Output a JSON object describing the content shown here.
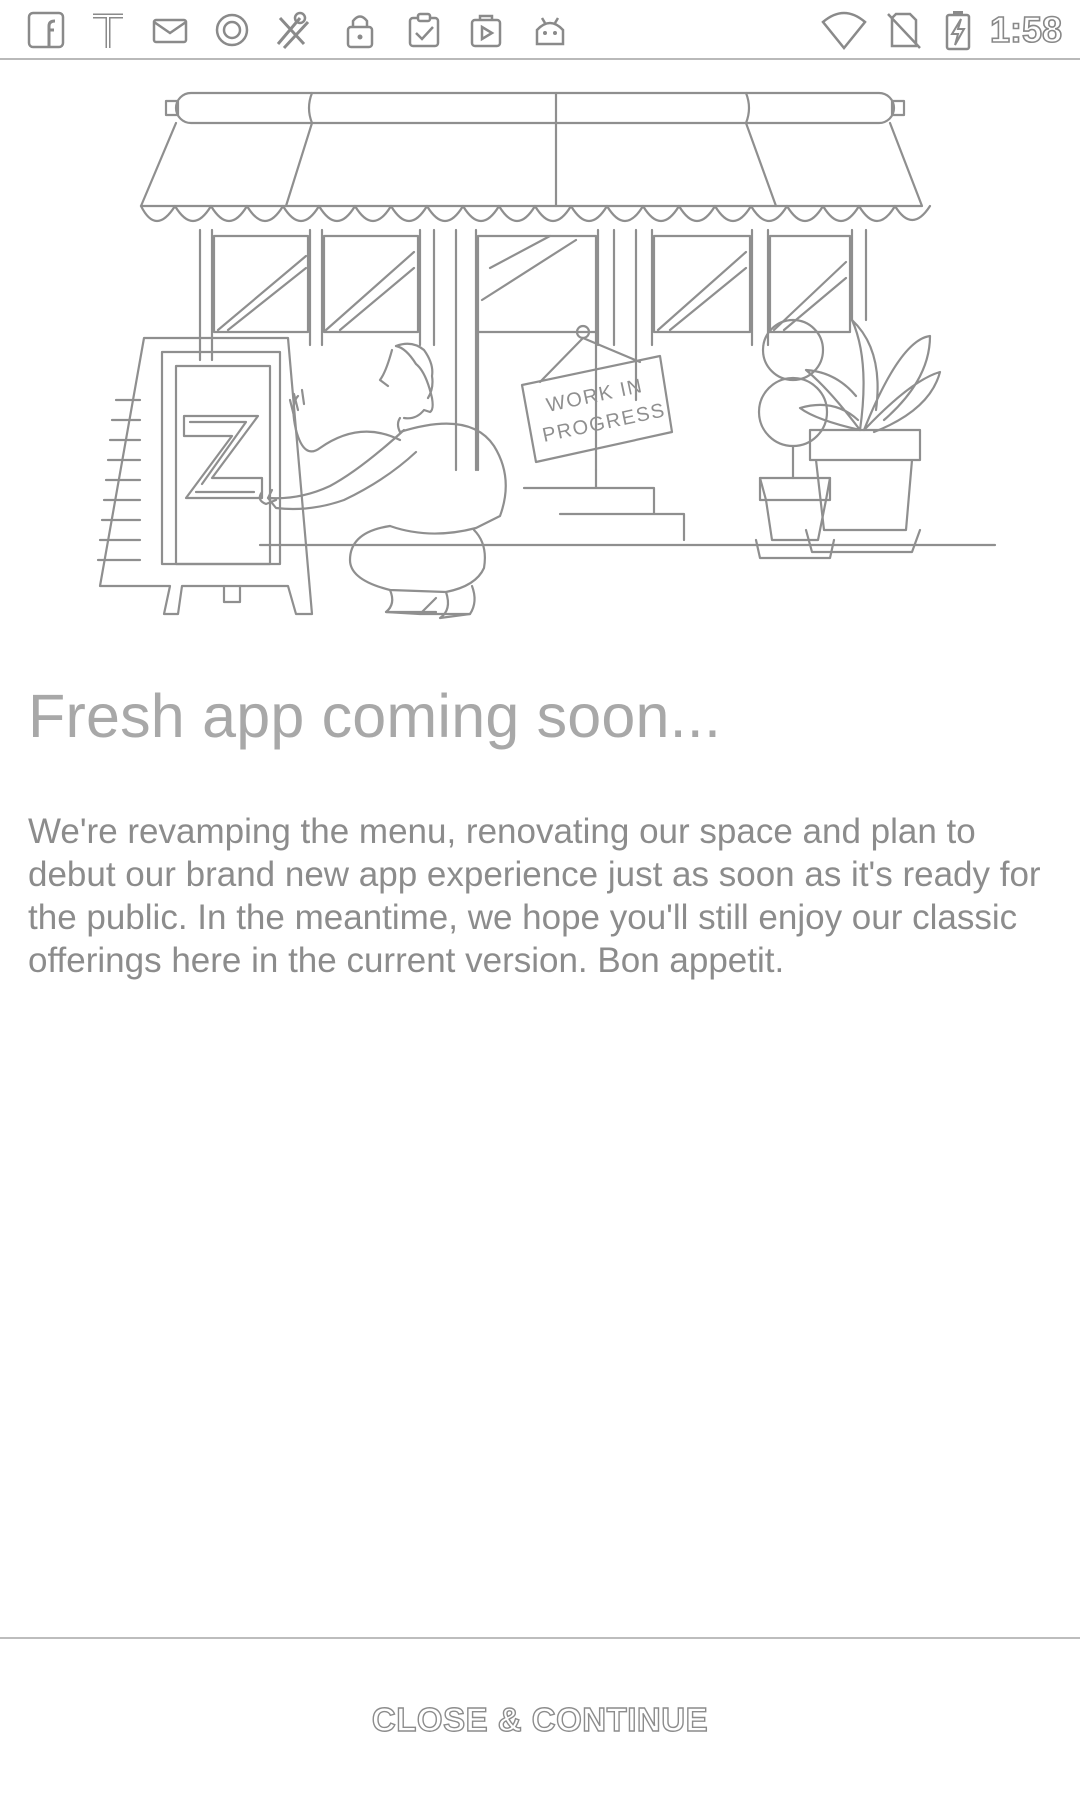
{
  "status_bar": {
    "left_icons": [
      "facebook-icon",
      "t-app-icon",
      "mail-icon",
      "circle-app-icon",
      "puzzle-app-icon",
      "lock-icon",
      "clipboard-check-icon",
      "play-bag-icon",
      "android-icon"
    ],
    "right_icons": [
      "wifi-icon",
      "no-sim-icon",
      "battery-charging-icon"
    ],
    "time": "1:58"
  },
  "illustration": {
    "sign_text_line1": "WORK IN",
    "sign_text_line2": "PROGRESS",
    "board_letter": "Z"
  },
  "main": {
    "title": "Fresh app coming soon...",
    "body": "We're revamping the menu, renovating our space and plan to debut our brand new app experience just as soon as it's ready for the public. In the meantime, we hope you'll still enjoy our classic offerings here in the current version. Bon appetit."
  },
  "footer": {
    "button_label": "CLOSE & CONTINUE"
  },
  "colors": {
    "title": "#a8a8a8",
    "body_text": "#8c8c8c",
    "line_art": "#8f8f8f",
    "divider": "#bdbdbd"
  }
}
